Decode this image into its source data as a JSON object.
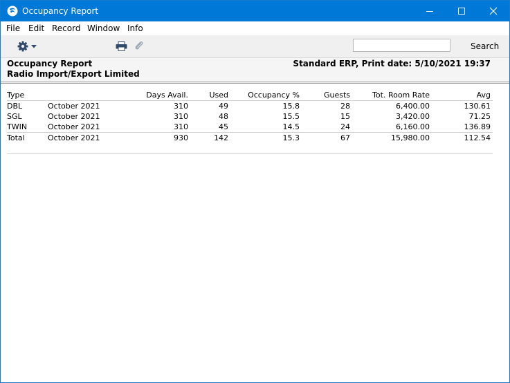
{
  "window": {
    "title": "Occupancy Report"
  },
  "menu": {
    "file": "File",
    "edit": "Edit",
    "record": "Record",
    "window": "Window",
    "info": "Info"
  },
  "toolbar": {
    "search_value": "",
    "search_label": "Search"
  },
  "report": {
    "title": "Occupancy Report",
    "company": "Radio Import/Export Limited",
    "print_info": "Standard ERP, Print date: 5/10/2021 19:37",
    "columns": [
      "Type",
      "",
      "Days Avail.",
      "Used",
      "Occupancy %",
      "Guests",
      "Tot. Room Rate",
      "Avg"
    ],
    "rows": [
      [
        "DBL",
        "October 2021",
        "310",
        "49",
        "15.8",
        "28",
        "6,400.00",
        "130.61"
      ],
      [
        "SGL",
        "October 2021",
        "310",
        "48",
        "15.5",
        "15",
        "3,420.00",
        "71.25"
      ],
      [
        "TWIN",
        "October 2021",
        "310",
        "45",
        "14.5",
        "24",
        "6,160.00",
        "136.89"
      ]
    ],
    "total": [
      "Total",
      "October 2021",
      "930",
      "142",
      "15.3",
      "67",
      "15,980.00",
      "112.54"
    ]
  },
  "colors": {
    "titlebar": "#0078d7",
    "toolbar": "#f0f0f0",
    "header_bg": "#f5f5f5"
  },
  "icons": [
    "app-logo-icon",
    "minimize-icon",
    "maximize-icon",
    "close-icon",
    "gear-icon",
    "dropdown-arrow-icon",
    "print-icon",
    "paperclip-icon"
  ]
}
